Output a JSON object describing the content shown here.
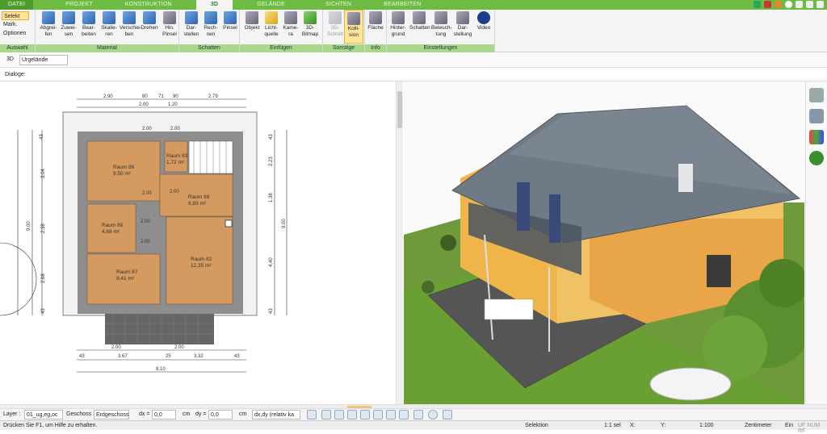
{
  "tabs": [
    "DATEI",
    "PROJEKT",
    "KONSTRUKTION",
    "3D",
    "GELÄNDE",
    "SICHTEN",
    "BEARBEITEN"
  ],
  "ribbon": {
    "selection": [
      "Selekt",
      "Mark.",
      "Optionen"
    ],
    "material": [
      "Abgrei-\nfen",
      "Zuwei-\nsen",
      "Bear-\nbeiten",
      "Skalie-\nren",
      "Verschie-\nben",
      "Drehen",
      "Hin.\nPinsel"
    ],
    "shadows": [
      "Dar-\nstellen",
      "Rech-\nnen",
      "Pinsel"
    ],
    "insert": [
      "Objekt",
      "Licht-\nquelle",
      "Kame-\nra",
      "3D-\nBitmap"
    ],
    "other": [
      "3D-\nSchnitt",
      "Kolli-\nsion"
    ],
    "info": [
      "Fläche"
    ],
    "settings": [
      "Hinter-\ngrund",
      "Schatten",
      "Beleuch-\ntung",
      "Dar-\nstellung",
      "Video"
    ],
    "groups": [
      "Auswahl",
      "Material",
      "Schatten",
      "Einfügen",
      "Sonstige",
      "Info",
      "Einstellungen"
    ]
  },
  "subbar": {
    "label": "3D",
    "dropdown": "Urgelände"
  },
  "dialog_label": "Dialoge:",
  "plan": {
    "rooms": [
      {
        "name": "Raum 86",
        "area": "9,50 m²"
      },
      {
        "name": "Raum 83",
        "area": "1,72 m²"
      },
      {
        "name": "Raum 88",
        "area": "6,83 m²"
      },
      {
        "name": "Raum 85",
        "area": "4,68 m²"
      },
      {
        "name": "Raum 87",
        "area": "9,41 m²"
      },
      {
        "name": "Raum 82",
        "area": "12,35 m²"
      }
    ],
    "dims_top": [
      "2.90",
      "80",
      "71",
      "90",
      "2.79",
      "2.00",
      "1.20"
    ],
    "dims_bottom": [
      "2.00",
      "2.00",
      "43",
      "3.67",
      "25",
      "3.32",
      "43",
      "8.10"
    ],
    "dims_left": [
      "43",
      "3.04",
      "9.00",
      "2.38",
      "2.68",
      "43"
    ],
    "dims_right": [
      "43",
      "2.23",
      "1.38",
      "9.00",
      "4.40",
      "43"
    ],
    "door_labels": [
      "2.00",
      "2.00",
      "2.00",
      "2.00",
      "2.00",
      "2.00"
    ]
  },
  "toolbar": {
    "layer_label": "Layer :",
    "layer_value": "01_ug,eg,oc",
    "floor_label": "Geschoss :",
    "floor_value": "Erdgeschoss",
    "dx_label": "dx =",
    "dx_value": "0,0",
    "dy_label": "dy =",
    "dy_value": "0,0",
    "unit": "cm",
    "mode": "dx,dy (relativ ka"
  },
  "status": {
    "hint": "Drücken Sie F1, um Hilfe zu erhalten.",
    "mode": "Selektion",
    "sel": "1:1 sel",
    "x": "X:",
    "y": "Y:",
    "scale": "1:100",
    "unit": "Zentimeter",
    "ein": "Ein",
    "flags": "UF NUM RF"
  }
}
